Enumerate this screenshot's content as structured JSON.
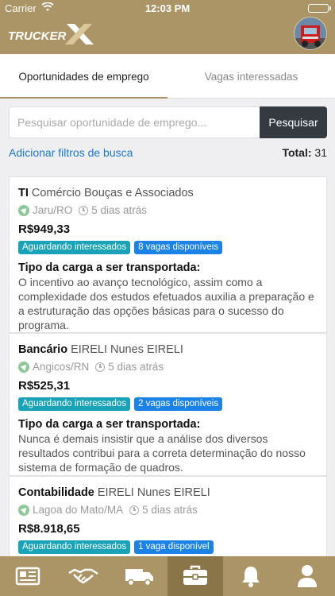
{
  "statusbar": {
    "carrier": "Carrier",
    "time": "12:03 PM"
  },
  "header": {
    "logo_text": "TRUCKER X",
    "avatar_icon": "truck-avatar"
  },
  "tabs": [
    {
      "label": "Oportunidades de emprego",
      "active": true
    },
    {
      "label": "Vagas interessadas",
      "active": false
    }
  ],
  "search": {
    "placeholder": "Pesquisar oportunidade de emprego...",
    "value": "",
    "button_label": "Pesquisar"
  },
  "filters": {
    "link_label": "Adicionar filtros de busca",
    "total_label": "Total:",
    "total_value": "31"
  },
  "jobs": [
    {
      "category": "TI",
      "company": "Comércio Bouças e Associados",
      "location": "Jaru/RO",
      "posted": "5 dias atrás",
      "price": "R$949,33",
      "status_badge": "Aguardando interessados",
      "vacancies_badge": "8 vagas disponíveis",
      "cargo_title": "Tipo da carga a ser transportada:",
      "cargo_desc": "O incentivo ao avanço tecnológico, assim como a complexidade dos estudos efetuados auxilia a preparação e a estruturação das opções básicas para o sucesso do programa."
    },
    {
      "category": "Bancário",
      "company": "EIRELI Nunes EIRELI",
      "location": "Angicos/RN",
      "posted": "5 dias atrás",
      "price": "R$525,31",
      "status_badge": "Aguardando interessados",
      "vacancies_badge": "2 vagas disponíveis",
      "cargo_title": "Tipo da carga a ser transportada:",
      "cargo_desc": "Nunca é demais insistir que a análise dos diversos resultados contribui para a correta determinação do nosso sistema de formação de quadros."
    },
    {
      "category": "Contabilidade",
      "company": "EIRELI Nunes EIRELI",
      "location": "Lagoa do Mato/MA",
      "posted": "5 dias atrás",
      "price": "R$8.918,65",
      "status_badge": "Aguardando interessados",
      "vacancies_badge": "1 vaga disponível",
      "cargo_title": "",
      "cargo_desc": ""
    }
  ],
  "bottom_nav": [
    {
      "icon": "newspaper-icon",
      "active": false
    },
    {
      "icon": "handshake-icon",
      "active": false
    },
    {
      "icon": "truck-icon",
      "active": false
    },
    {
      "icon": "briefcase-icon",
      "active": true
    },
    {
      "icon": "bell-icon",
      "active": false
    },
    {
      "icon": "user-icon",
      "active": false
    }
  ],
  "colors": {
    "brand": "#ab9566",
    "brand_dark": "#8a7549",
    "link": "#1b77d3",
    "badge_teal": "#1aa3b8",
    "badge_blue": "#1b82e6"
  }
}
